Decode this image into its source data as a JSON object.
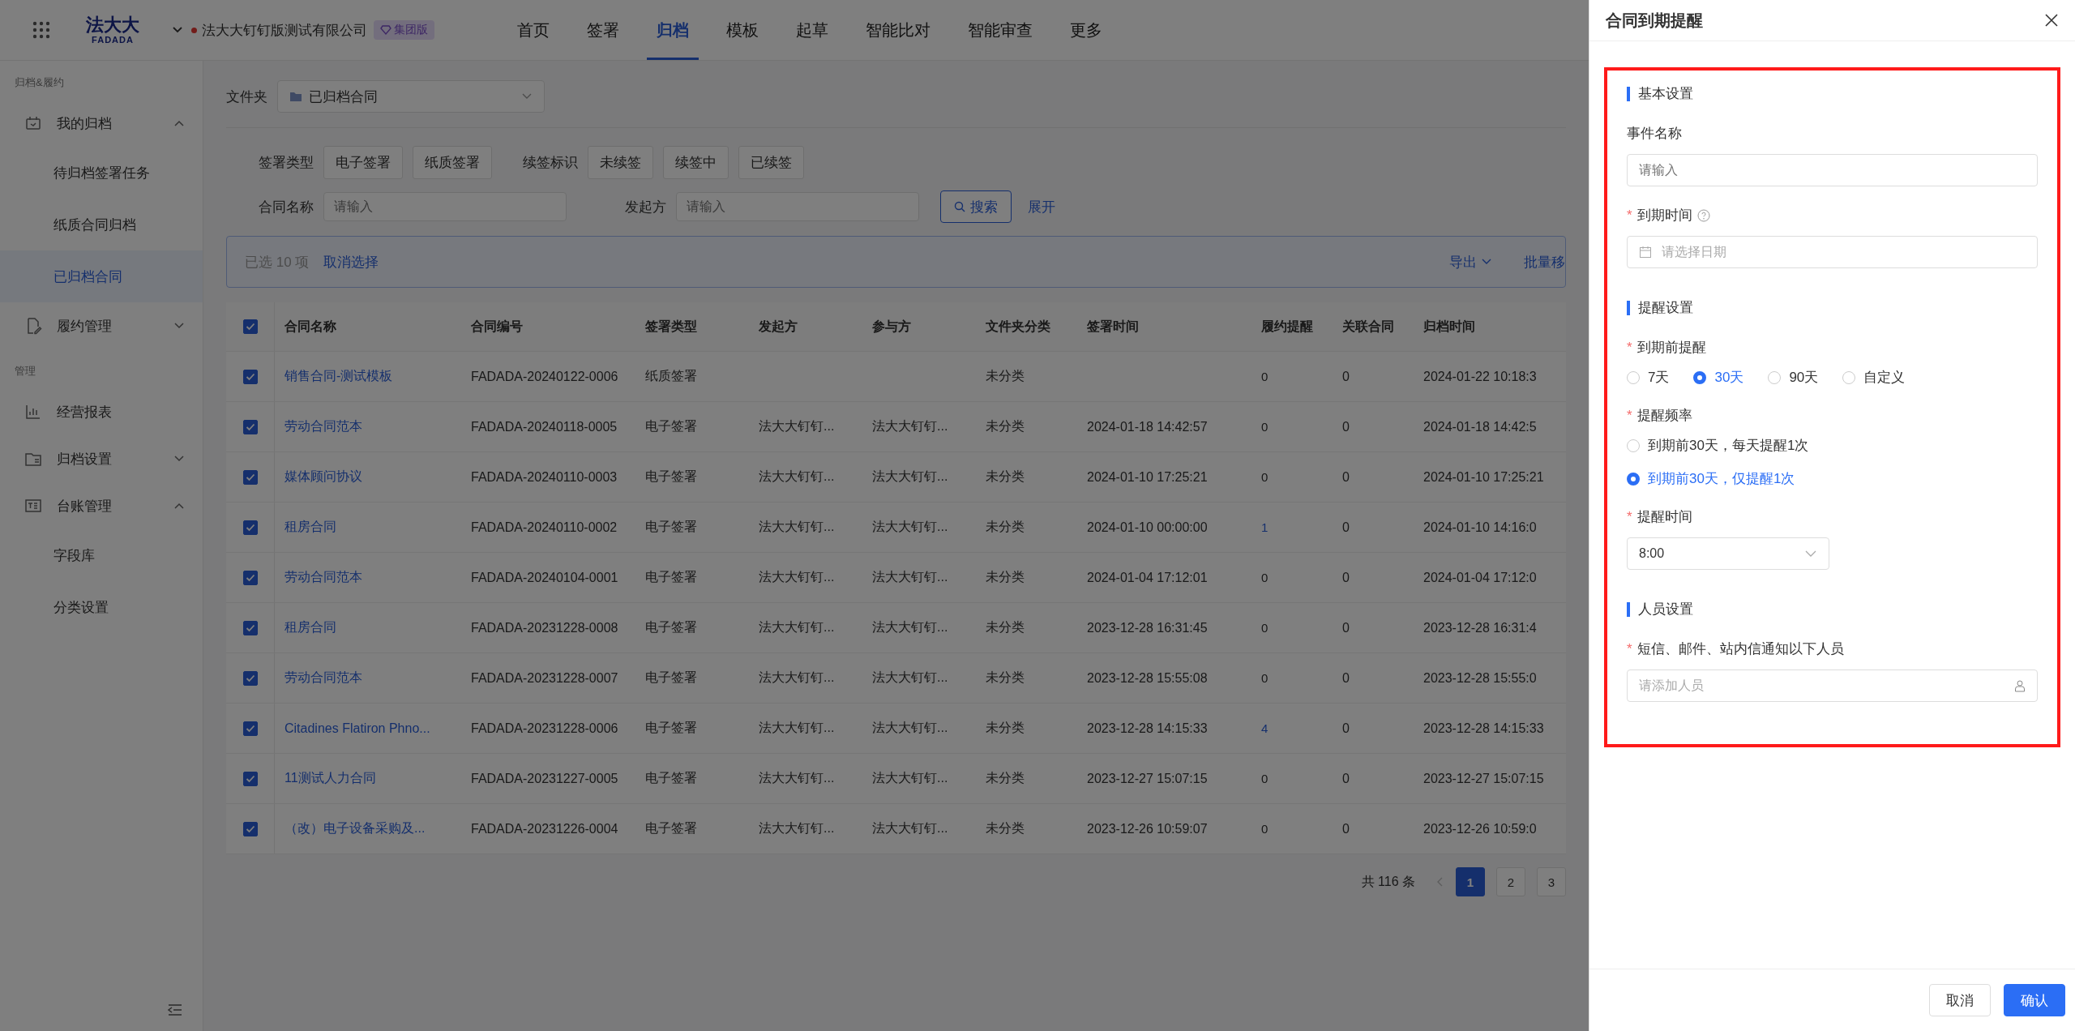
{
  "topbar": {
    "logo": "法大大",
    "logo_sub": "FADADA",
    "company": "法大大钉钉版测试有限公司",
    "badge": "集团版",
    "nav": [
      {
        "label": "首页",
        "selected": false
      },
      {
        "label": "签署",
        "selected": false
      },
      {
        "label": "归档",
        "selected": true
      },
      {
        "label": "模板",
        "selected": false
      },
      {
        "label": "起草",
        "selected": false
      },
      {
        "label": "智能比对",
        "selected": false
      },
      {
        "label": "智能审查",
        "selected": false
      },
      {
        "label": "更多",
        "selected": false
      }
    ]
  },
  "sidebar": {
    "sections": [
      {
        "label": "归档&履约",
        "items": [
          {
            "kind": "group",
            "label": "我的归档",
            "expanded": true,
            "children": [
              {
                "label": "待归档签署任务",
                "selected": false
              },
              {
                "label": "纸质合同归档",
                "selected": false
              },
              {
                "label": "已归档合同",
                "selected": true
              }
            ]
          },
          {
            "kind": "group",
            "label": "履约管理",
            "expanded": false
          }
        ]
      },
      {
        "label": "管理",
        "items": [
          {
            "kind": "link",
            "label": "经营报表"
          },
          {
            "kind": "group",
            "label": "归档设置",
            "expanded": false
          },
          {
            "kind": "group",
            "label": "台账管理",
            "expanded": true,
            "children": [
              {
                "label": "字段库",
                "selected": false
              },
              {
                "label": "分类设置",
                "selected": false
              }
            ]
          }
        ]
      }
    ]
  },
  "folder": {
    "label": "文件夹",
    "value": "已归档合同"
  },
  "filters": {
    "groups": [
      {
        "label": "签署类型",
        "tags": [
          {
            "label": "电子签署",
            "selected": false
          },
          {
            "label": "纸质签署",
            "selected": false
          }
        ]
      },
      {
        "label": "续签标识",
        "tags": [
          {
            "label": "未续签",
            "selected": false
          },
          {
            "label": "续签中",
            "selected": false
          },
          {
            "label": "已续签",
            "selected": false
          }
        ]
      }
    ],
    "fields": [
      {
        "label": "合同名称",
        "placeholder": "请输入"
      },
      {
        "label": "发起方",
        "placeholder": "请输入"
      }
    ],
    "search_button": "搜索",
    "expand_link": "展开"
  },
  "selection_bar": {
    "count": "已选 10 项",
    "clear": "取消选择",
    "export": "导出",
    "batch": "批量移"
  },
  "table": {
    "all_checked": true,
    "columns": [
      "合同名称",
      "合同编号",
      "签署类型",
      "发起方",
      "参与方",
      "文件夹分类",
      "签署时间",
      "履约提醒",
      "关联合同",
      "归档时间"
    ],
    "rows": [
      {
        "checked": true,
        "reminder_link": false,
        "cells": [
          "销售合同-测试模板",
          "FADADA-20240122-0006",
          "纸质签署",
          "",
          "",
          "未分类",
          "",
          "0",
          "0",
          "2024-01-22 10:18:3"
        ]
      },
      {
        "checked": true,
        "reminder_link": false,
        "cells": [
          "劳动合同范本",
          "FADADA-20240118-0005",
          "电子签署",
          "法大大钉钉...",
          "法大大钉钉...",
          "未分类",
          "2024-01-18 14:42:57",
          "0",
          "0",
          "2024-01-18 14:42:5"
        ]
      },
      {
        "checked": true,
        "reminder_link": false,
        "cells": [
          "媒体顾问协议",
          "FADADA-20240110-0003",
          "电子签署",
          "法大大钉钉...",
          "法大大钉钉...",
          "未分类",
          "2024-01-10 17:25:21",
          "0",
          "0",
          "2024-01-10 17:25:21"
        ]
      },
      {
        "checked": true,
        "reminder_link": true,
        "cells": [
          "租房合同",
          "FADADA-20240110-0002",
          "电子签署",
          "法大大钉钉...",
          "法大大钉钉...",
          "未分类",
          "2024-01-10 00:00:00",
          "1",
          "0",
          "2024-01-10 14:16:0"
        ]
      },
      {
        "checked": true,
        "reminder_link": false,
        "cells": [
          "劳动合同范本",
          "FADADA-20240104-0001",
          "电子签署",
          "法大大钉钉...",
          "法大大钉钉...",
          "未分类",
          "2024-01-04 17:12:01",
          "0",
          "0",
          "2024-01-04 17:12:0"
        ]
      },
      {
        "checked": true,
        "reminder_link": false,
        "cells": [
          "租房合同",
          "FADADA-20231228-0008",
          "电子签署",
          "法大大钉钉...",
          "法大大钉钉...",
          "未分类",
          "2023-12-28 16:31:45",
          "0",
          "0",
          "2023-12-28 16:31:4"
        ]
      },
      {
        "checked": true,
        "reminder_link": false,
        "cells": [
          "劳动合同范本",
          "FADADA-20231228-0007",
          "电子签署",
          "法大大钉钉...",
          "法大大钉钉...",
          "未分类",
          "2023-12-28 15:55:08",
          "0",
          "0",
          "2023-12-28 15:55:0"
        ]
      },
      {
        "checked": true,
        "reminder_link": true,
        "cells": [
          "Citadines Flatiron Phno...",
          "FADADA-20231228-0006",
          "电子签署",
          "法大大钉钉...",
          "法大大钉钉...",
          "未分类",
          "2023-12-28 14:15:33",
          "4",
          "0",
          "2023-12-28 14:15:33"
        ]
      },
      {
        "checked": true,
        "reminder_link": false,
        "cells": [
          "11测试人力合同",
          "FADADA-20231227-0005",
          "电子签署",
          "法大大钉钉...",
          "法大大钉钉...",
          "未分类",
          "2023-12-27 15:07:15",
          "0",
          "0",
          "2023-12-27 15:07:15"
        ]
      },
      {
        "checked": true,
        "reminder_link": false,
        "cells": [
          "（改）电子设备采购及...",
          "FADADA-20231226-0004",
          "电子签署",
          "法大大钉钉...",
          "法大大钉钉...",
          "未分类",
          "2023-12-26 10:59:07",
          "0",
          "0",
          "2023-12-26 10:59:0"
        ]
      }
    ]
  },
  "pagination": {
    "total": "共 116 条",
    "pages": [
      {
        "label": "1",
        "selected": true
      },
      {
        "label": "2",
        "selected": false
      },
      {
        "label": "3",
        "selected": false
      }
    ]
  },
  "drawer": {
    "title": "合同到期提醒",
    "highlighted": true,
    "required_mark": "*",
    "sections": [
      {
        "title": "基本设置",
        "fields": [
          {
            "kind": "input",
            "label": "事件名称",
            "required": false,
            "help": false,
            "placeholder": "请输入"
          },
          {
            "kind": "date",
            "label": "到期时间",
            "required": true,
            "help": true,
            "placeholder": "请选择日期"
          }
        ]
      },
      {
        "title": "提醒设置",
        "fields": [
          {
            "kind": "radio",
            "label": "到期前提醒",
            "required": true,
            "help": false,
            "vertical": false,
            "options": [
              {
                "label": "7天",
                "selected": false
              },
              {
                "label": "30天",
                "selected": true
              },
              {
                "label": "90天",
                "selected": false
              },
              {
                "label": "自定义",
                "selected": false
              }
            ]
          },
          {
            "kind": "radio",
            "label": "提醒频率",
            "required": true,
            "help": false,
            "vertical": true,
            "options": [
              {
                "label": "到期前30天，每天提醒1次",
                "selected": false
              },
              {
                "label": "到期前30天，仅提醒1次",
                "selected": true
              }
            ]
          },
          {
            "kind": "select",
            "label": "提醒时间",
            "required": true,
            "help": false,
            "value": "8:00"
          }
        ]
      },
      {
        "title": "人员设置",
        "fields": [
          {
            "kind": "people",
            "label": "短信、邮件、站内信通知以下人员",
            "required": true,
            "help": false,
            "placeholder": "请添加人员"
          }
        ]
      }
    ],
    "buttons": [
      {
        "label": "取消",
        "primary": false
      },
      {
        "label": "确认",
        "primary": true
      }
    ]
  }
}
